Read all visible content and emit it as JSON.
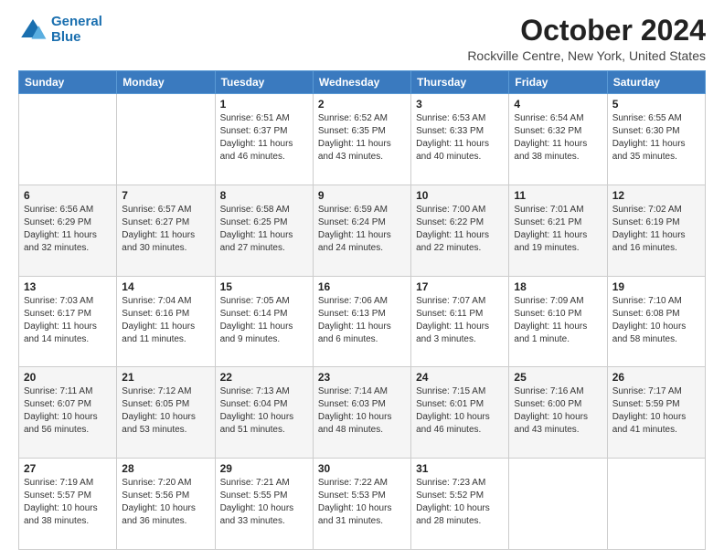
{
  "header": {
    "logo_line1": "General",
    "logo_line2": "Blue",
    "title": "October 2024",
    "subtitle": "Rockville Centre, New York, United States"
  },
  "days_of_week": [
    "Sunday",
    "Monday",
    "Tuesday",
    "Wednesday",
    "Thursday",
    "Friday",
    "Saturday"
  ],
  "weeks": [
    [
      {
        "day": "",
        "info": ""
      },
      {
        "day": "",
        "info": ""
      },
      {
        "day": "1",
        "info": "Sunrise: 6:51 AM\nSunset: 6:37 PM\nDaylight: 11 hours and 46 minutes."
      },
      {
        "day": "2",
        "info": "Sunrise: 6:52 AM\nSunset: 6:35 PM\nDaylight: 11 hours and 43 minutes."
      },
      {
        "day": "3",
        "info": "Sunrise: 6:53 AM\nSunset: 6:33 PM\nDaylight: 11 hours and 40 minutes."
      },
      {
        "day": "4",
        "info": "Sunrise: 6:54 AM\nSunset: 6:32 PM\nDaylight: 11 hours and 38 minutes."
      },
      {
        "day": "5",
        "info": "Sunrise: 6:55 AM\nSunset: 6:30 PM\nDaylight: 11 hours and 35 minutes."
      }
    ],
    [
      {
        "day": "6",
        "info": "Sunrise: 6:56 AM\nSunset: 6:29 PM\nDaylight: 11 hours and 32 minutes."
      },
      {
        "day": "7",
        "info": "Sunrise: 6:57 AM\nSunset: 6:27 PM\nDaylight: 11 hours and 30 minutes."
      },
      {
        "day": "8",
        "info": "Sunrise: 6:58 AM\nSunset: 6:25 PM\nDaylight: 11 hours and 27 minutes."
      },
      {
        "day": "9",
        "info": "Sunrise: 6:59 AM\nSunset: 6:24 PM\nDaylight: 11 hours and 24 minutes."
      },
      {
        "day": "10",
        "info": "Sunrise: 7:00 AM\nSunset: 6:22 PM\nDaylight: 11 hours and 22 minutes."
      },
      {
        "day": "11",
        "info": "Sunrise: 7:01 AM\nSunset: 6:21 PM\nDaylight: 11 hours and 19 minutes."
      },
      {
        "day": "12",
        "info": "Sunrise: 7:02 AM\nSunset: 6:19 PM\nDaylight: 11 hours and 16 minutes."
      }
    ],
    [
      {
        "day": "13",
        "info": "Sunrise: 7:03 AM\nSunset: 6:17 PM\nDaylight: 11 hours and 14 minutes."
      },
      {
        "day": "14",
        "info": "Sunrise: 7:04 AM\nSunset: 6:16 PM\nDaylight: 11 hours and 11 minutes."
      },
      {
        "day": "15",
        "info": "Sunrise: 7:05 AM\nSunset: 6:14 PM\nDaylight: 11 hours and 9 minutes."
      },
      {
        "day": "16",
        "info": "Sunrise: 7:06 AM\nSunset: 6:13 PM\nDaylight: 11 hours and 6 minutes."
      },
      {
        "day": "17",
        "info": "Sunrise: 7:07 AM\nSunset: 6:11 PM\nDaylight: 11 hours and 3 minutes."
      },
      {
        "day": "18",
        "info": "Sunrise: 7:09 AM\nSunset: 6:10 PM\nDaylight: 11 hours and 1 minute."
      },
      {
        "day": "19",
        "info": "Sunrise: 7:10 AM\nSunset: 6:08 PM\nDaylight: 10 hours and 58 minutes."
      }
    ],
    [
      {
        "day": "20",
        "info": "Sunrise: 7:11 AM\nSunset: 6:07 PM\nDaylight: 10 hours and 56 minutes."
      },
      {
        "day": "21",
        "info": "Sunrise: 7:12 AM\nSunset: 6:05 PM\nDaylight: 10 hours and 53 minutes."
      },
      {
        "day": "22",
        "info": "Sunrise: 7:13 AM\nSunset: 6:04 PM\nDaylight: 10 hours and 51 minutes."
      },
      {
        "day": "23",
        "info": "Sunrise: 7:14 AM\nSunset: 6:03 PM\nDaylight: 10 hours and 48 minutes."
      },
      {
        "day": "24",
        "info": "Sunrise: 7:15 AM\nSunset: 6:01 PM\nDaylight: 10 hours and 46 minutes."
      },
      {
        "day": "25",
        "info": "Sunrise: 7:16 AM\nSunset: 6:00 PM\nDaylight: 10 hours and 43 minutes."
      },
      {
        "day": "26",
        "info": "Sunrise: 7:17 AM\nSunset: 5:59 PM\nDaylight: 10 hours and 41 minutes."
      }
    ],
    [
      {
        "day": "27",
        "info": "Sunrise: 7:19 AM\nSunset: 5:57 PM\nDaylight: 10 hours and 38 minutes."
      },
      {
        "day": "28",
        "info": "Sunrise: 7:20 AM\nSunset: 5:56 PM\nDaylight: 10 hours and 36 minutes."
      },
      {
        "day": "29",
        "info": "Sunrise: 7:21 AM\nSunset: 5:55 PM\nDaylight: 10 hours and 33 minutes."
      },
      {
        "day": "30",
        "info": "Sunrise: 7:22 AM\nSunset: 5:53 PM\nDaylight: 10 hours and 31 minutes."
      },
      {
        "day": "31",
        "info": "Sunrise: 7:23 AM\nSunset: 5:52 PM\nDaylight: 10 hours and 28 minutes."
      },
      {
        "day": "",
        "info": ""
      },
      {
        "day": "",
        "info": ""
      }
    ]
  ]
}
